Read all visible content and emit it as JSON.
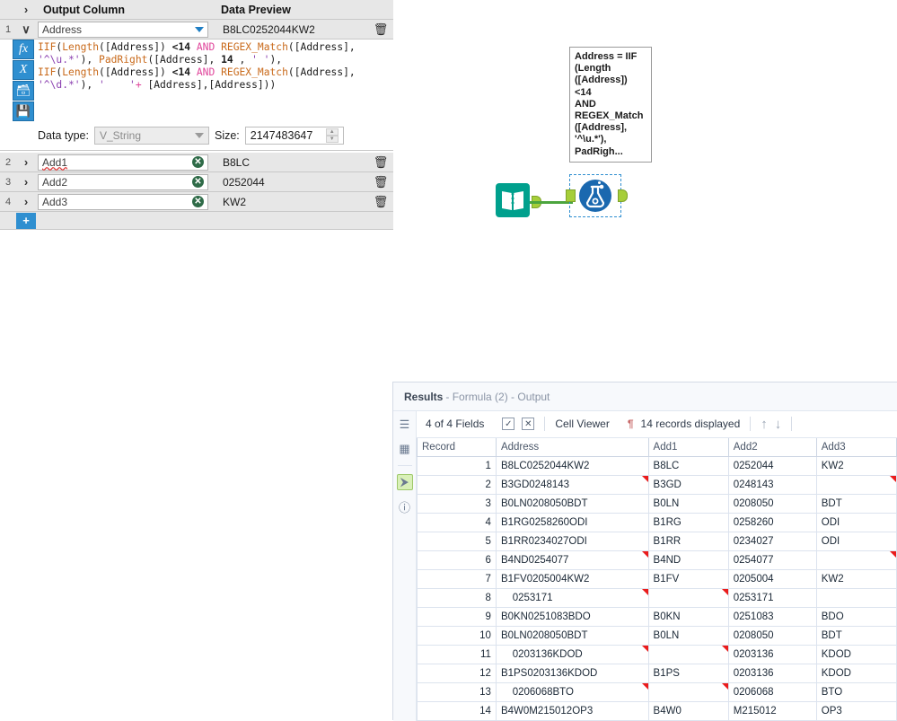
{
  "config_panel": {
    "headers": {
      "expand": "›",
      "output_column": "Output Column",
      "data_preview": "Data Preview"
    },
    "rows": [
      {
        "num": "1",
        "chevron": "∨",
        "output_column": "Address",
        "data_preview": "B8LC0252044KW2",
        "expanded": true
      },
      {
        "num": "2",
        "chevron": "›",
        "output_column": "Add1",
        "data_preview": "B8LC",
        "expanded": false
      },
      {
        "num": "3",
        "chevron": "›",
        "output_column": "Add2",
        "data_preview": "0252044",
        "expanded": false
      },
      {
        "num": "4",
        "chevron": "›",
        "output_column": "Add3",
        "data_preview": "KW2",
        "expanded": false
      }
    ],
    "add_row_label": "+",
    "formula_toolbar": [
      {
        "name": "fx-icon",
        "glyph": "fx"
      },
      {
        "name": "variable-x-icon",
        "glyph": "𝑋"
      },
      {
        "name": "open-folder-icon",
        "glyph": "🗁"
      },
      {
        "name": "save-icon",
        "glyph": "💾"
      }
    ],
    "formula_text": "IIF(Length([Address]) <14 AND REGEX_Match([Address], '^\\u.*'), PadRight([Address], 14 , ' '),\nIIF(Length([Address]) <14 AND REGEX_Match([Address], '^\\d.*'), '    '+ [Address],[Address]))",
    "data_type_label": "Data type:",
    "data_type_value": "V_String",
    "size_label": "Size:",
    "size_value": "2147483647"
  },
  "canvas": {
    "input_node_name": "input-data-tool",
    "formula_node_name": "formula-tool",
    "tooltip_text": "Address = IIF\n(Length\n([Address]) <14\nAND\nREGEX_Match\n([Address],\n'^\\u.*'),\nPadRigh..."
  },
  "results": {
    "title_main": "Results",
    "title_sub": "- Formula (2) - Output",
    "toolbar": {
      "fields_label": "4 of 4 Fields",
      "check_icon": "✓",
      "x_icon": "☒",
      "cell_viewer_label": "Cell Viewer",
      "pilcrow": "¶",
      "records_label": "14 records displayed",
      "up_arrow": "↑",
      "down_arrow": "↓"
    },
    "rail_icons": [
      {
        "name": "list-icon",
        "glyph": "☰"
      },
      {
        "name": "page-icon",
        "glyph": "◧"
      },
      {
        "name": "output-anchor-icon",
        "glyph": "⮞"
      },
      {
        "name": "help-icon",
        "glyph": "?"
      }
    ],
    "columns": [
      "Record",
      "Address",
      "Add1",
      "Add2",
      "Add3"
    ],
    "rows": [
      {
        "record": "1",
        "address": "B8LC0252044KW2",
        "add1": "B8LC",
        "add2": "0252044",
        "add3": "KW2",
        "flags": []
      },
      {
        "record": "2",
        "address": "B3GD0248143",
        "add1": "B3GD",
        "add2": "0248143",
        "add3": "",
        "flags": [
          "address",
          "add3"
        ]
      },
      {
        "record": "3",
        "address": "B0LN0208050BDT",
        "add1": "B0LN",
        "add2": "0208050",
        "add3": "BDT",
        "flags": []
      },
      {
        "record": "4",
        "address": "B1RG0258260ODI",
        "add1": "B1RG",
        "add2": "0258260",
        "add3": "ODI",
        "flags": []
      },
      {
        "record": "5",
        "address": "B1RR0234027ODI",
        "add1": "B1RR",
        "add2": "0234027",
        "add3": "ODI",
        "flags": []
      },
      {
        "record": "6",
        "address": "B4ND0254077",
        "add1": "B4ND",
        "add2": "0254077",
        "add3": "",
        "flags": [
          "address",
          "add3"
        ]
      },
      {
        "record": "7",
        "address": "B1FV0205004KW2",
        "add1": "B1FV",
        "add2": "0205004",
        "add3": "KW2",
        "flags": []
      },
      {
        "record": "8",
        "address": "    0253171",
        "add1": "",
        "add2": "0253171",
        "add3": "",
        "flags": [
          "address",
          "add1"
        ]
      },
      {
        "record": "9",
        "address": "B0KN0251083BDO",
        "add1": "B0KN",
        "add2": "0251083",
        "add3": "BDO",
        "flags": []
      },
      {
        "record": "10",
        "address": "B0LN0208050BDT",
        "add1": "B0LN",
        "add2": "0208050",
        "add3": "BDT",
        "flags": []
      },
      {
        "record": "11",
        "address": "    0203136KDOD",
        "add1": "",
        "add2": "0203136",
        "add3": "KDOD",
        "flags": [
          "address",
          "add1"
        ]
      },
      {
        "record": "12",
        "address": "B1PS0203136KDOD",
        "add1": "B1PS",
        "add2": "0203136",
        "add3": "KDOD",
        "flags": []
      },
      {
        "record": "13",
        "address": "    0206068BTO",
        "add1": "",
        "add2": "0206068",
        "add3": "BTO",
        "flags": [
          "address",
          "add1"
        ]
      },
      {
        "record": "14",
        "address": "B4W0M215012OP3",
        "add1": "B4W0",
        "add2": "M215012",
        "add3": "OP3",
        "flags": []
      }
    ]
  },
  "colors": {
    "accent_blue": "#2f8fd0",
    "node_blue": "#1a68af",
    "node_teal": "#00a08d",
    "port_green": "#a6ce39",
    "wire_green": "#4ca53e",
    "flag_red": "#ea1c1c"
  }
}
